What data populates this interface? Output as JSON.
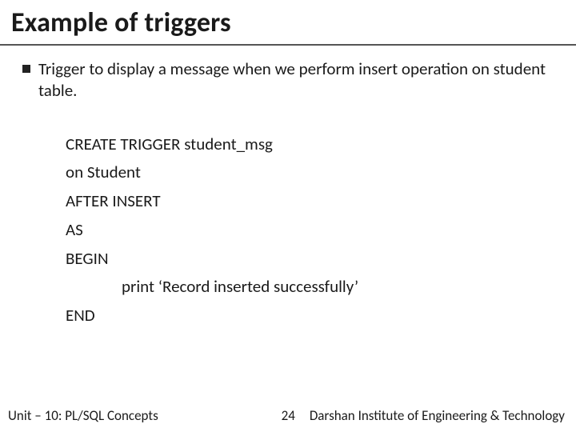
{
  "title": "Example of triggers",
  "bullet": "Trigger to display a message when we perform insert operation on student table.",
  "code": {
    "l1": "CREATE TRIGGER student_msg",
    "l2": "on Student",
    "l3": "AFTER INSERT",
    "l4": "AS",
    "l5": "BEGIN",
    "l6": "print ‘Record inserted successfully’",
    "l7": "END"
  },
  "footer": {
    "unit": "Unit – 10: PL/SQL Concepts",
    "page": "24",
    "org": "Darshan Institute of Engineering & Technology"
  }
}
